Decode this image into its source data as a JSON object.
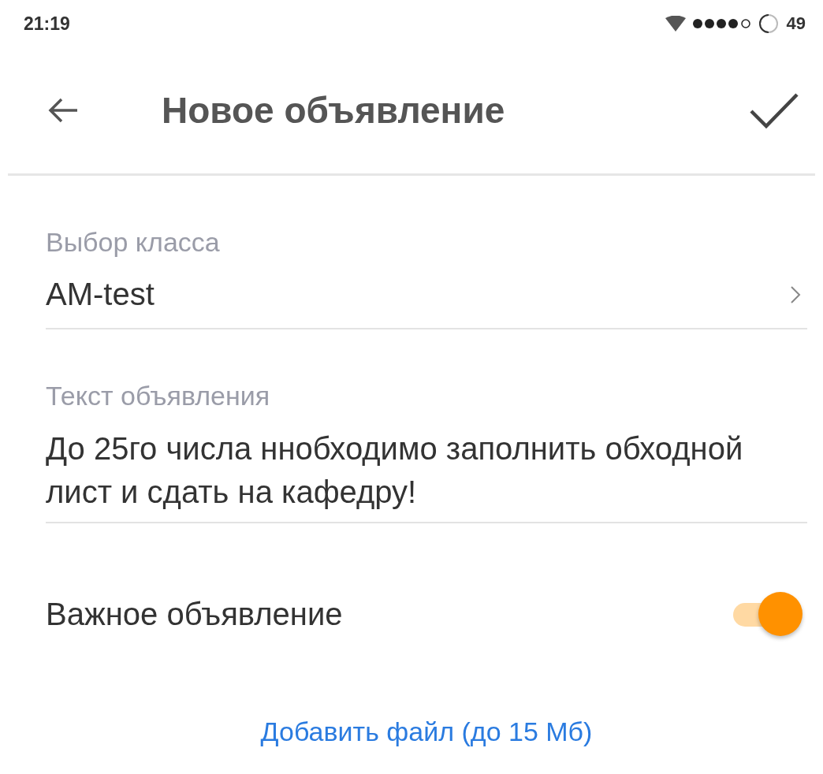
{
  "status_bar": {
    "time": "21:19",
    "battery": "49"
  },
  "header": {
    "title": "Новое объявление"
  },
  "fields": [
    {
      "kind": "select",
      "label": "Выбор класса",
      "value": "AM-test"
    },
    {
      "kind": "text",
      "label": "Текст объявления",
      "value": "До 25го числа ннобходимо заполнить обходной лист и сдать на кафедру!"
    }
  ],
  "important": {
    "label": "Важное объявление",
    "on": true
  },
  "add_file_link": "Добавить файл (до 15 Мб)"
}
